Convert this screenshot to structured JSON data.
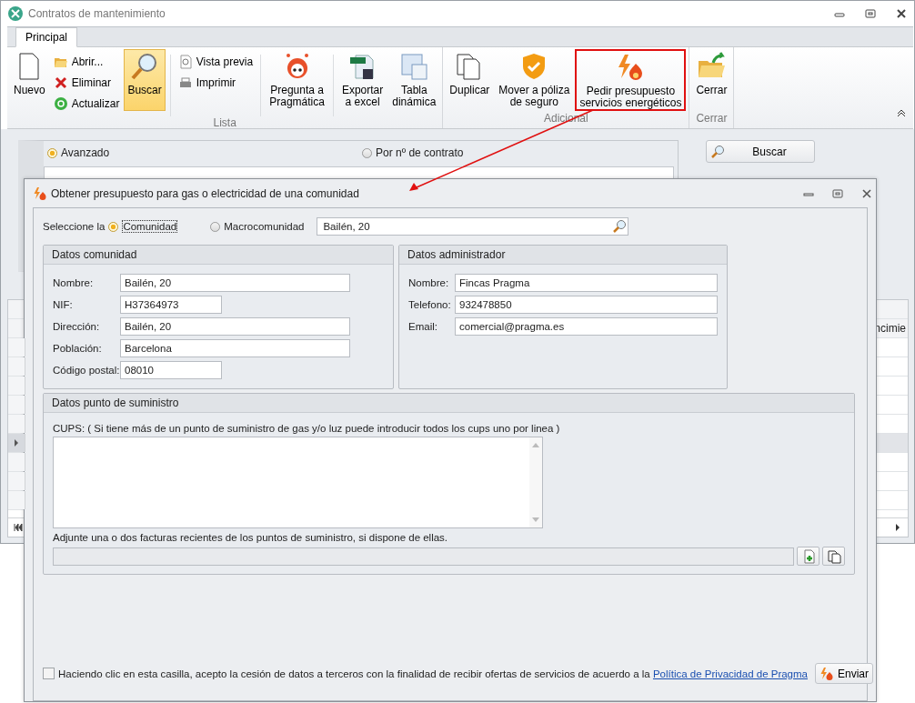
{
  "window": {
    "title": "Contratos de mantenimiento"
  },
  "ribbon": {
    "tabs": [
      {
        "label": "Principal",
        "selected": true
      }
    ],
    "groups": [
      {
        "label": "Lista",
        "items": [
          {
            "kind": "large",
            "label": "Nuevo",
            "selected": false,
            "annotated": false
          },
          {
            "kind": "stack",
            "items": [
              {
                "label": "Abrir..."
              },
              {
                "label": "Eliminar"
              },
              {
                "label": "Actualizar"
              }
            ]
          },
          {
            "kind": "large",
            "label": "Buscar",
            "selected": true,
            "annotated": false
          },
          {
            "kind": "separator"
          },
          {
            "kind": "stack",
            "items": [
              {
                "label": "Vista previa"
              },
              {
                "label": "Imprimir"
              }
            ]
          },
          {
            "kind": "separator"
          },
          {
            "kind": "large",
            "label": "Pregunta a\nPragmática",
            "selected": false,
            "annotated": false
          },
          {
            "kind": "separator"
          },
          {
            "kind": "large",
            "label": "Exportar\na excel",
            "selected": false,
            "annotated": false
          },
          {
            "kind": "large",
            "label": "Tabla\ndinámica",
            "selected": false,
            "annotated": false
          }
        ]
      },
      {
        "label": "Adicional",
        "items": [
          {
            "kind": "large",
            "label": "Duplicar",
            "selected": false,
            "annotated": false
          },
          {
            "kind": "large",
            "label": "Mover a póliza\nde seguro",
            "selected": false,
            "annotated": false
          },
          {
            "kind": "large",
            "label": "Pedir presupuesto\nservicios energéticos",
            "selected": false,
            "annotated": true
          }
        ]
      },
      {
        "label": "Cerrar",
        "items": [
          {
            "kind": "large",
            "label": "Cerrar",
            "selected": false,
            "annotated": false
          }
        ]
      }
    ]
  },
  "search": {
    "modes": [
      {
        "label": "Avanzado",
        "selected": true
      },
      {
        "label": "Por nº de contrato",
        "selected": false
      }
    ],
    "button": "Buscar"
  },
  "grid": {
    "column_header": "ncimie",
    "rows": [
      {
        "selected": false
      },
      {
        "selected": false
      },
      {
        "selected": false
      },
      {
        "selected": false
      },
      {
        "selected": true
      },
      {
        "selected": false
      },
      {
        "selected": false
      },
      {
        "selected": false
      }
    ]
  },
  "dialog": {
    "title": "Obtener presupuesto para gas o electricidad de una comunidad",
    "selector_label": "Seleccione la",
    "scope": [
      {
        "label": "Comunidad",
        "selected": true
      },
      {
        "label": "Macrocomunidad",
        "selected": false
      }
    ],
    "scope_value": "Bailén, 20",
    "community": {
      "title": "Datos comunidad",
      "fields": [
        {
          "label": "Nombre:",
          "value": "Bailén, 20"
        },
        {
          "label": "NIF:",
          "value": "H37364973"
        },
        {
          "label": "Dirección:",
          "value": "Bailén, 20"
        },
        {
          "label": "Población:",
          "value": "Barcelona"
        },
        {
          "label": "Código postal:",
          "value": "08010"
        }
      ]
    },
    "administrator": {
      "title": "Datos administrador",
      "fields": [
        {
          "label": "Nombre:",
          "value": "Fincas Pragma"
        },
        {
          "label": "Telefono:",
          "value": "932478850"
        },
        {
          "label": "Email:",
          "value": "comercial@pragma.es"
        }
      ]
    },
    "supply": {
      "title": "Datos punto de suministro",
      "cups_label": "CUPS: ( Si tiene más de un punto de suministro de gas y/o luz puede introducir todos los cups uno por linea )",
      "attach_label": "Adjunte una o dos facturas recientes de los puntos de suministro, si dispone de ellas."
    },
    "consent": {
      "checked": false,
      "text": "Haciendo clic en esta casilla, acepto la cesión de datos a terceros con la finalidad de recibir ofertas de servicios de acuerdo a la ",
      "link": "Política de Privacidad de Pragma"
    },
    "submit": "Enviar"
  }
}
